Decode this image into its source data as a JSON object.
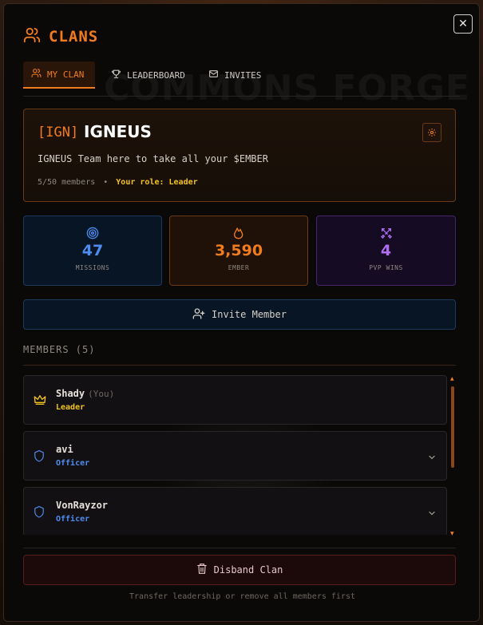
{
  "watermark": "COMMONS FORGE",
  "header": {
    "title": "CLANS",
    "icon": "users-icon"
  },
  "close_icon": "✕",
  "tabs": [
    {
      "label": "MY CLAN",
      "icon": "users-icon",
      "active": true
    },
    {
      "label": "LEADERBOARD",
      "icon": "trophy-icon",
      "active": false
    },
    {
      "label": "INVITES",
      "icon": "mail-icon",
      "active": false
    }
  ],
  "clan": {
    "tag": "[IGN]",
    "name": "IGNEUS",
    "description": "IGNEUS Team here to take all your $EMBER",
    "members_count": "5/50 members",
    "separator": "•",
    "role": "Your role: Leader"
  },
  "stats": {
    "missions": {
      "value": "47",
      "label": "MISSIONS",
      "icon": "target-icon"
    },
    "ember": {
      "value": "3,590",
      "label": "EMBER",
      "icon": "flame-icon"
    },
    "pvp": {
      "value": "4",
      "label": "PVP WINS",
      "icon": "swords-icon"
    }
  },
  "invite_button": {
    "label": "Invite Member",
    "icon": "user-plus-icon"
  },
  "members_section": {
    "heading": "MEMBERS (5)",
    "members": [
      {
        "name": "Shady",
        "suffix": "(You)",
        "role": "Leader",
        "icon": "crown-icon"
      },
      {
        "name": "avi",
        "role": "Officer",
        "icon": "shield-icon"
      },
      {
        "name": "VonRayzor",
        "role": "Officer",
        "icon": "shield-icon"
      }
    ]
  },
  "disband_button": {
    "label": "Disband Clan",
    "icon": "trash-icon"
  },
  "footnote": "Transfer leadership or remove all members first",
  "colors": {
    "accent": "#f07c1d",
    "leader": "#f3c31b",
    "officer": "#4f8cf0",
    "pvp": "#b06ef2",
    "danger": "#5a1c1c"
  }
}
